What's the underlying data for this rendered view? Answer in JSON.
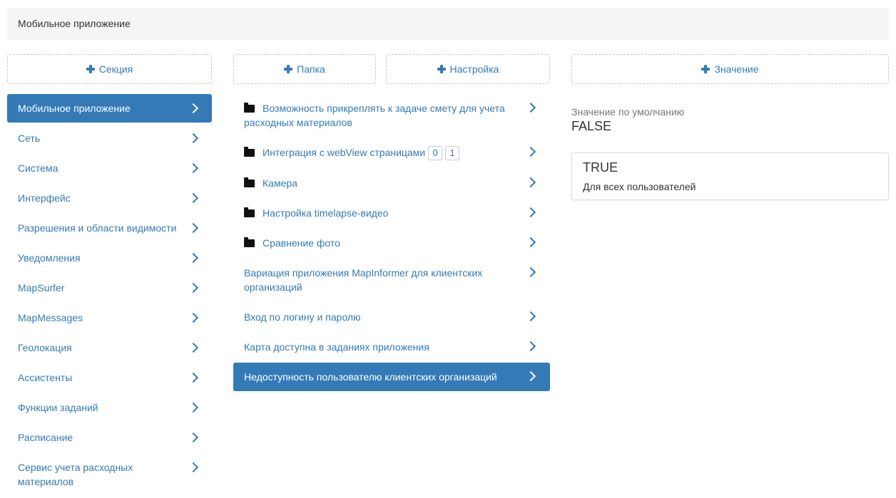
{
  "breadcrumb": {
    "title": "Мобильное приложение"
  },
  "buttons": {
    "section": "Секция",
    "folder": "Папка",
    "setting": "Настройка",
    "value": "Значение"
  },
  "sidebar": {
    "items": [
      {
        "label": "Мобильное приложение",
        "active": true
      },
      {
        "label": "Сеть"
      },
      {
        "label": "Система"
      },
      {
        "label": "Интерфейс"
      },
      {
        "label": "Разрешения и области видимости"
      },
      {
        "label": "Уведомления"
      },
      {
        "label": "MapSurfer"
      },
      {
        "label": "MapMessages"
      },
      {
        "label": "Геолокация"
      },
      {
        "label": "Ассистенты"
      },
      {
        "label": "Функции заданий"
      },
      {
        "label": "Расписание"
      },
      {
        "label": "Сервис учета расходных материалов"
      }
    ]
  },
  "middle": {
    "items": [
      {
        "label": "Возможность прикреплять к задаче смету для учета расходных материалов",
        "folder": true
      },
      {
        "label": "Интеграция с webView страницами",
        "folder": true,
        "badges": [
          "0",
          "1"
        ]
      },
      {
        "label": "Камера",
        "folder": true
      },
      {
        "label": "Настройка timelapse-видео",
        "folder": true
      },
      {
        "label": "Сравнение фото",
        "folder": true
      },
      {
        "label": "Вариация приложения MapInformer для клиентских организаций"
      },
      {
        "label": "Вход по логину и паролю"
      },
      {
        "label": "Карта доступна в заданиях приложения"
      },
      {
        "label": "Недоступность пользователю клиентских организаций",
        "active": true
      }
    ]
  },
  "value_panel": {
    "default_label": "Значение по умолчанию",
    "default_value": "FALSE",
    "card_value": "TRUE",
    "card_scope": "Для всех пользователей"
  },
  "icons": {
    "plus": "plus-icon",
    "chevron": "chevron-right-icon",
    "folder": "folder-icon"
  },
  "colors": {
    "accent": "#337ab7",
    "breadcrumb_bg": "#f5f5f5"
  }
}
